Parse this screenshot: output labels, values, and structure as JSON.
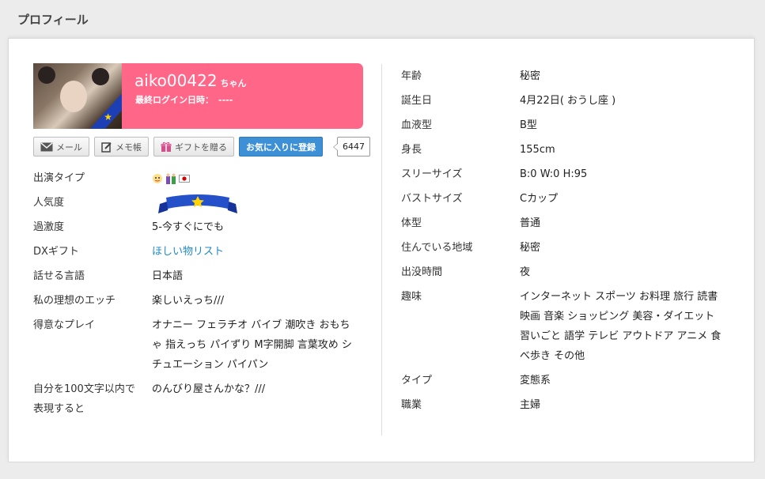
{
  "section_title": "プロフィール",
  "profile": {
    "name": "aiko00422",
    "name_suffix": "ちゃん",
    "last_login_label": "最終ログイン日時：",
    "last_login_value": "----"
  },
  "actions": {
    "mail": "メール",
    "memo": "メモ帳",
    "gift": "ギフトを贈る",
    "favorite": "お気に入りに登録",
    "favorite_count": "6447"
  },
  "left_details": [
    {
      "label": "出演タイプ",
      "value": ""
    },
    {
      "label": "人気度",
      "value": ""
    },
    {
      "label": "過激度",
      "value": "5-今すぐにでも"
    },
    {
      "label": "DXギフト",
      "value": "ほしい物リスト"
    },
    {
      "label": "話せる言語",
      "value": "日本語"
    },
    {
      "label": "私の理想のエッチ",
      "value": "楽しいえっち///"
    },
    {
      "label": "得意なプレイ",
      "value": "オナニー フェラチオ バイブ 潮吹き おもちゃ 指えっち パイずり M字開脚 言葉攻め シチュエーション パイパン"
    },
    {
      "label": "自分を100文字以内で表現すると",
      "value": "のんびり屋さんかな？///"
    }
  ],
  "right_details": [
    {
      "label": "年齢",
      "value": "秘密"
    },
    {
      "label": "誕生日",
      "value": "4月22日( おうし座 )"
    },
    {
      "label": "血液型",
      "value": "B型"
    },
    {
      "label": "身長",
      "value": "155cm"
    },
    {
      "label": "スリーサイズ",
      "value": "B:0 W:0 H:95"
    },
    {
      "label": "バストサイズ",
      "value": "Cカップ"
    },
    {
      "label": "体型",
      "value": "普通"
    },
    {
      "label": "住んでいる地域",
      "value": "秘密"
    },
    {
      "label": "出没時間",
      "value": "夜"
    },
    {
      "label": "趣味",
      "value": "インターネット スポーツ お料理 旅行 読書 映画 音楽 ショッピング 美容・ダイエット 習いごと 語学 テレビ アウトドア アニメ 食べ歩き その他"
    },
    {
      "label": "タイプ",
      "value": "変態系"
    },
    {
      "label": "職業",
      "value": "主婦"
    }
  ],
  "colors": {
    "banner": "#ff6688",
    "favorite_button": "#3d8fd6",
    "link": "#1e88c7"
  }
}
